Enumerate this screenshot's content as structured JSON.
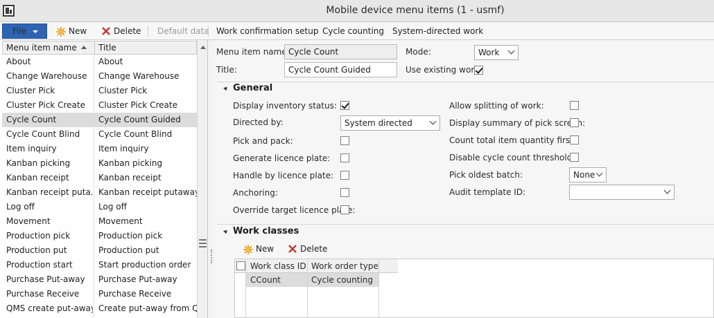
{
  "window": {
    "title": "Mobile device menu items (1 - usmf)"
  },
  "actionbar": {
    "file": "File",
    "new": "New",
    "delete": "Delete",
    "default_data": "Default data",
    "work_confirmation_setup": "Work confirmation setup",
    "cycle_counting": "Cycle counting",
    "system_directed_work": "System-directed work"
  },
  "list": {
    "columns": [
      "Menu item name",
      "Title"
    ],
    "selected_index": 4,
    "rows": [
      {
        "name": "About",
        "title": "About"
      },
      {
        "name": "Change Warehouse",
        "title": "Change Warehouse"
      },
      {
        "name": "Cluster Pick",
        "title": "Cluster Pick"
      },
      {
        "name": "Cluster Pick Create",
        "title": "Cluster Pick Create"
      },
      {
        "name": "Cycle Count",
        "title": "Cycle Count Guided"
      },
      {
        "name": "Cycle Count Blind",
        "title": "Cycle Count Blind"
      },
      {
        "name": "Item inquiry",
        "title": "Item inquiry"
      },
      {
        "name": "Kanban picking",
        "title": "Kanban picking"
      },
      {
        "name": "Kanban receipt",
        "title": "Kanban receipt"
      },
      {
        "name": "Kanban receipt puta...",
        "title": "Kanban receipt putaway"
      },
      {
        "name": "Log off",
        "title": "Log off"
      },
      {
        "name": "Movement",
        "title": "Movement"
      },
      {
        "name": "Production pick",
        "title": "Production pick"
      },
      {
        "name": "Production put",
        "title": "Production put"
      },
      {
        "name": "Production start",
        "title": "Start production order"
      },
      {
        "name": "Purchase Put-away",
        "title": "Purchase Put-away"
      },
      {
        "name": "Purchase Receive",
        "title": "Purchase Receive"
      },
      {
        "name": "QMS create put-away",
        "title": "Create put-away from Q..."
      }
    ]
  },
  "header_form": {
    "menu_item_name_label": "Menu item name:",
    "menu_item_name_value": "Cycle Count",
    "title_label": "Title:",
    "title_value": "Cycle Count Guided",
    "mode_label": "Mode:",
    "mode_value": "Work",
    "use_existing_work_label": "Use existing work:",
    "use_existing_work_checked": true
  },
  "general": {
    "title": "General",
    "display_inventory_status_label": "Display inventory status:",
    "display_inventory_status_checked": true,
    "directed_by_label": "Directed by:",
    "directed_by_value": "System directed",
    "pick_and_pack_label": "Pick and pack:",
    "generate_licence_plate_label": "Generate licence plate:",
    "handle_by_licence_plate_label": "Handle by licence plate:",
    "anchoring_label": "Anchoring:",
    "override_target_licence_plate_label": "Override target licence plate:",
    "allow_splitting_label": "Allow splitting of work:",
    "display_summary_label": "Display summary of pick screen:",
    "count_total_label": "Count total item quantity first:",
    "disable_thresholds_label": "Disable cycle count thresholds:",
    "pick_oldest_batch_label": "Pick oldest batch:",
    "pick_oldest_batch_value": "None",
    "audit_template_label": "Audit template ID:",
    "audit_template_value": ""
  },
  "work_classes": {
    "title": "Work classes",
    "new": "New",
    "delete": "Delete",
    "columns": [
      "Work class ID",
      "Work order type"
    ],
    "rows": [
      {
        "id": "CCount",
        "type": "Cycle counting"
      }
    ]
  },
  "colors": {
    "file_button": "#2f64b3",
    "selected_row": "#dcdcdc",
    "delete_x": "#c0392b",
    "new_star": "#f0a020"
  }
}
